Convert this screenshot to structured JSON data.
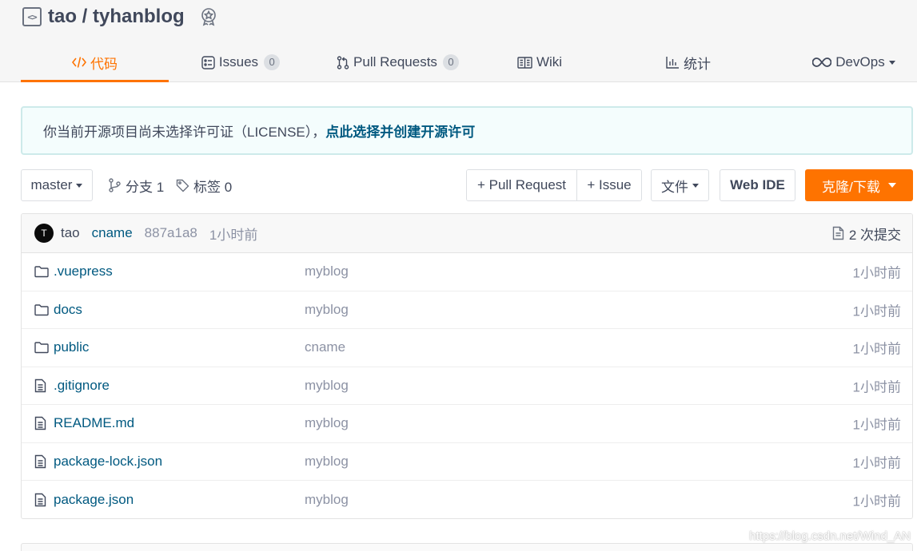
{
  "repo": {
    "title": "tao / tyhanblog"
  },
  "tabs": [
    {
      "label": "代码",
      "icon": "code-icon",
      "active": true
    },
    {
      "label": "Issues",
      "icon": "issues-icon",
      "count": "0"
    },
    {
      "label": "Pull Requests",
      "icon": "pull-request-icon",
      "count": "0"
    },
    {
      "label": "Wiki",
      "icon": "wiki-icon"
    },
    {
      "label": "统计",
      "icon": "chart-icon"
    },
    {
      "label": "DevOps",
      "icon": "devops-icon"
    }
  ],
  "notice": {
    "text": "你当前开源项目尚未选择许可证（LICENSE），",
    "link": "点此选择并创建开源许可"
  },
  "toolbar": {
    "branch": "master",
    "branches": "分支 1",
    "tags": "标签 0",
    "pull_request": "+ Pull Request",
    "issue": "+ Issue",
    "file": "文件",
    "web_ide": "Web IDE",
    "clone": "克隆/下载"
  },
  "commit": {
    "avatar_letter": "T",
    "author": "tao",
    "message": "cname",
    "sha": "887a1a8",
    "time": "1小时前",
    "count": "2 次提交"
  },
  "files": [
    {
      "name": ".vuepress",
      "type": "folder",
      "message": "myblog",
      "time": "1小时前"
    },
    {
      "name": "docs",
      "type": "folder",
      "message": "myblog",
      "time": "1小时前"
    },
    {
      "name": "public",
      "type": "folder",
      "message": "cname",
      "time": "1小时前"
    },
    {
      "name": ".gitignore",
      "type": "file",
      "message": "myblog",
      "time": "1小时前"
    },
    {
      "name": "README.md",
      "type": "file",
      "message": "myblog",
      "time": "1小时前"
    },
    {
      "name": "package-lock.json",
      "type": "file",
      "message": "myblog",
      "time": "1小时前"
    },
    {
      "name": "package.json",
      "type": "file",
      "message": "myblog",
      "time": "1小时前"
    }
  ],
  "watermark": "https://blog.csdn.net/Wind_AN",
  "colors": {
    "accent": "#fe7300",
    "link": "#005980",
    "muted": "#8c92a4",
    "text": "#40485b"
  }
}
